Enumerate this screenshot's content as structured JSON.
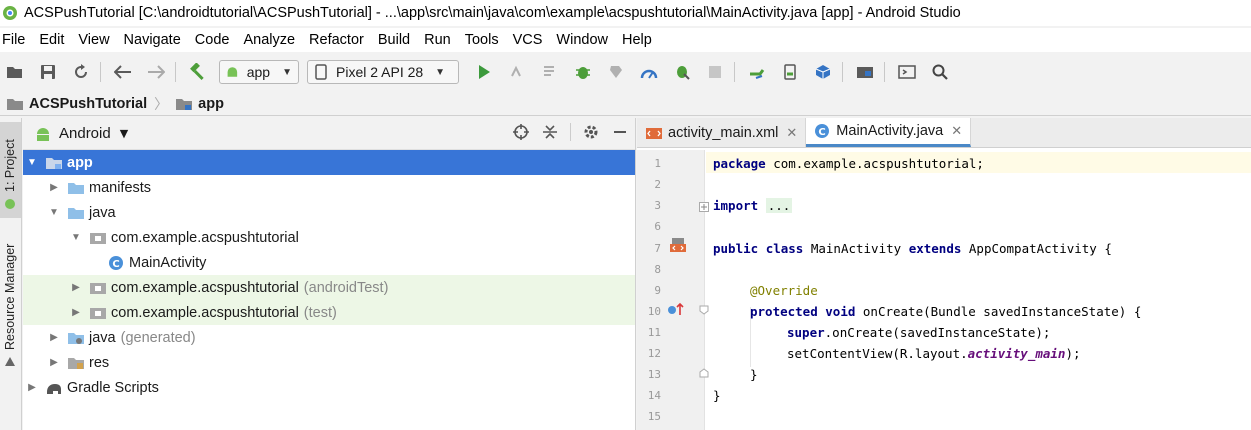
{
  "window": {
    "title": "ACSPushTutorial [C:\\androidtutorial\\ACSPushTutorial] - ...\\app\\src\\main\\java\\com\\example\\acspushtutorial\\MainActivity.java [app] - Android Studio"
  },
  "menu": [
    "File",
    "Edit",
    "View",
    "Navigate",
    "Code",
    "Analyze",
    "Refactor",
    "Build",
    "Run",
    "Tools",
    "VCS",
    "Window",
    "Help"
  ],
  "toolbar": {
    "module_config": "app",
    "device": "Pixel 2 API 28"
  },
  "breadcrumb": {
    "project": "ACSPushTutorial",
    "module": "app"
  },
  "left_strip": {
    "project_tab": "1: Project",
    "resource_manager_tab": "Resource Manager"
  },
  "project_panel": {
    "view": "Android",
    "tree": [
      {
        "label": "app",
        "suffix": ""
      },
      {
        "label": "manifests",
        "suffix": ""
      },
      {
        "label": "java",
        "suffix": ""
      },
      {
        "label": "com.example.acspushtutorial",
        "suffix": ""
      },
      {
        "label": "MainActivity",
        "suffix": ""
      },
      {
        "label": "com.example.acspushtutorial",
        "suffix": "(androidTest)"
      },
      {
        "label": "com.example.acspushtutorial",
        "suffix": "(test)"
      },
      {
        "label": "java",
        "suffix": "(generated)"
      },
      {
        "label": "res",
        "suffix": ""
      },
      {
        "label": "Gradle Scripts",
        "suffix": ""
      }
    ]
  },
  "editor": {
    "tabs": [
      {
        "label": "activity_main.xml",
        "active": false
      },
      {
        "label": "MainActivity.java",
        "active": true
      }
    ],
    "line_numbers": [
      "1",
      "2",
      "3",
      "6",
      "7",
      "8",
      "9",
      "10",
      "11",
      "12",
      "13",
      "14",
      "15"
    ],
    "code": {
      "l1_kw": "package",
      "l1_rest": " com.example.acspushtutorial;",
      "l3_kw": "import",
      "l3_fold": "...",
      "l7_kw1": "public",
      "l7_kw2": "class",
      "l7_mid": " MainActivity ",
      "l7_kw3": "extends",
      "l7_rest": " AppCompatActivity {",
      "l9_ann": "@Override",
      "l10_kw1": "protected",
      "l10_kw2": "void",
      "l10_rest": " onCreate(Bundle savedInstanceState) {",
      "l11_kw": "super",
      "l11_rest": ".onCreate(savedInstanceState);",
      "l12_pre": "setContentView(R.layout.",
      "l12_field": "activity_main",
      "l12_post": ");",
      "l13": "}",
      "l14": "}"
    }
  }
}
